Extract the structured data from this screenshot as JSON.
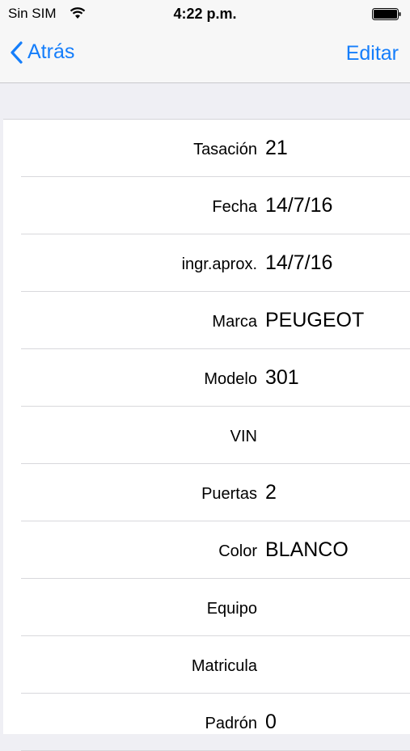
{
  "status_bar": {
    "carrier": "Sin SIM",
    "time": "4:22 p.m."
  },
  "nav": {
    "back_label": "Atrás",
    "edit_label": "Editar"
  },
  "colors": {
    "accent": "#157efb",
    "background": "#efeff4"
  },
  "fields": [
    {
      "label": "Tasación",
      "value": "21"
    },
    {
      "label": "Fecha",
      "value": "14/7/16"
    },
    {
      "label": "ingr.aprox.",
      "value": "14/7/16"
    },
    {
      "label": "Marca",
      "value": "PEUGEOT"
    },
    {
      "label": "Modelo",
      "value": "301"
    },
    {
      "label": "VIN",
      "value": ""
    },
    {
      "label": "Puertas",
      "value": "2"
    },
    {
      "label": "Color",
      "value": "BLANCO"
    },
    {
      "label": "Equipo",
      "value": ""
    },
    {
      "label": "Matricula",
      "value": ""
    },
    {
      "label": "Padrón",
      "value": "0"
    }
  ]
}
